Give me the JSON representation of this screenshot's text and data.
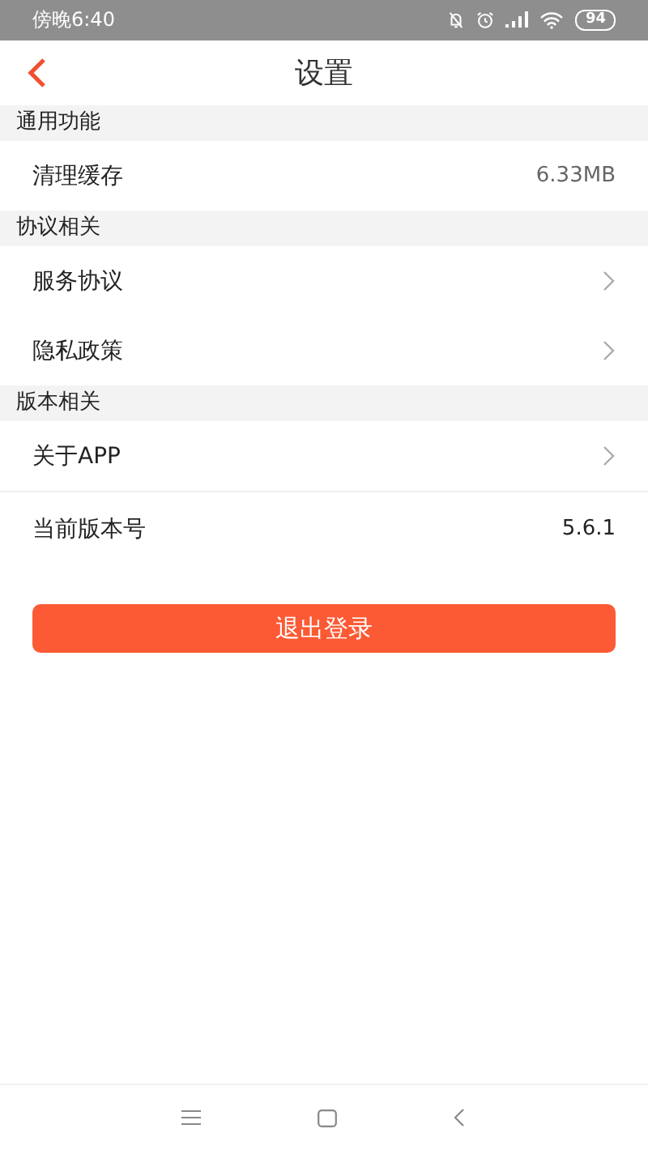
{
  "status_bar": {
    "time": "傍晚6:40",
    "battery": "94"
  },
  "header": {
    "title": "设置"
  },
  "sections": [
    {
      "title": "通用功能",
      "rows": [
        {
          "kind": "value",
          "label": "清理缓存",
          "value": "6.33MB"
        }
      ]
    },
    {
      "title": "协议相关",
      "rows": [
        {
          "kind": "link",
          "label": "服务协议"
        },
        {
          "kind": "link",
          "label": "隐私政策"
        }
      ]
    },
    {
      "title": "版本相关",
      "rows": [
        {
          "kind": "link",
          "label": "关于APP"
        },
        {
          "kind": "value",
          "label": "当前版本号",
          "value": "5.6.1"
        }
      ]
    }
  ],
  "logout_button": "退出登录"
}
